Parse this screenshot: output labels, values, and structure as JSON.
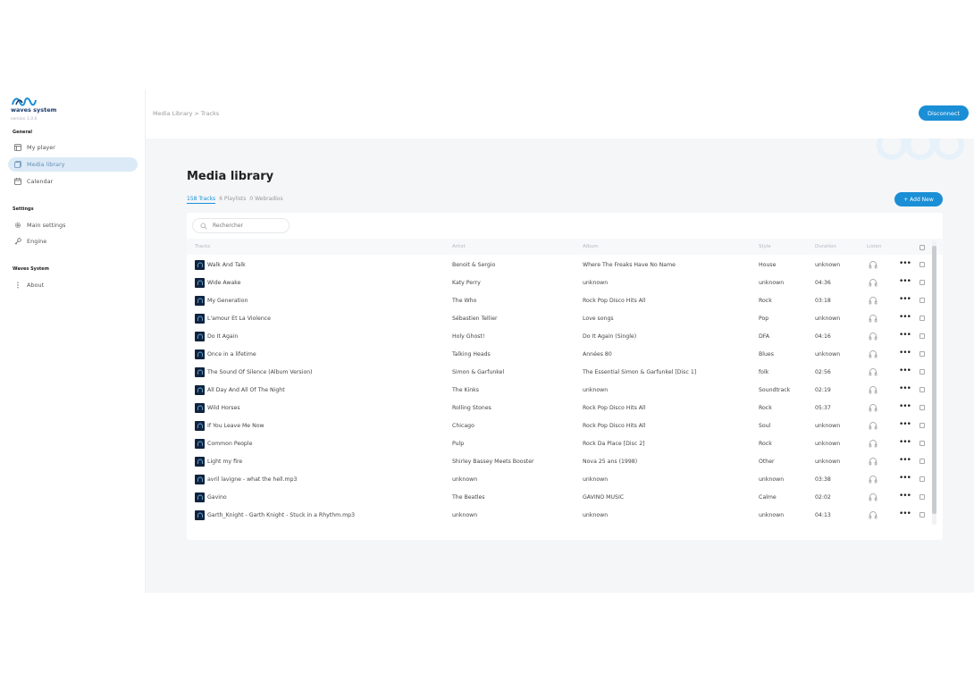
{
  "brand": {
    "name": "waves system",
    "version": "version 1.0.0"
  },
  "sidebar": {
    "sections": [
      {
        "title": "General",
        "items": [
          {
            "label": "My player",
            "icon": "player-icon"
          },
          {
            "label": "Media library",
            "icon": "library-icon",
            "active": true
          },
          {
            "label": "Calendar",
            "icon": "calendar-icon"
          }
        ]
      },
      {
        "title": "Settings",
        "items": [
          {
            "label": "Main settings",
            "icon": "gear-icon"
          },
          {
            "label": "Engine",
            "icon": "key-icon"
          }
        ]
      },
      {
        "title": "Waves System",
        "items": [
          {
            "label": "About",
            "icon": "dots-vertical-icon"
          }
        ]
      }
    ]
  },
  "topbar": {
    "breadcrumb": "Media Library > Tracks",
    "disconnect_label": "Disconnect"
  },
  "main": {
    "title": "Media library",
    "subtabs": [
      "158 Tracks",
      "6 Playlists",
      "0 Webradios"
    ],
    "add_new_label": "+ Add New",
    "search_placeholder": "Rechercher",
    "columns": [
      "Tracks",
      "Artist",
      "Album",
      "Style",
      "Duration",
      "Listen"
    ],
    "rows": [
      {
        "track": "Walk And Talk",
        "artist": "Benoit & Sergio",
        "album": "Where The Freaks Have No Name",
        "style": "House",
        "duration": "unknown"
      },
      {
        "track": "Wide Awake",
        "artist": "Katy Perry",
        "album": "unknown",
        "style": "unknown",
        "duration": "04:36"
      },
      {
        "track": "My Generation",
        "artist": "The Who",
        "album": "Rock Pop Disco Hits All",
        "style": "Rock",
        "duration": "03:18"
      },
      {
        "track": "L'amour Et La Violence",
        "artist": "Sébastien Tellier",
        "album": "Love songs",
        "style": "Pop",
        "duration": "unknown"
      },
      {
        "track": "Do It Again",
        "artist": "Holy Ghost!",
        "album": "Do It Again (Single)",
        "style": "DFA",
        "duration": "04:16"
      },
      {
        "track": "Once in a lifetime",
        "artist": "Talking Heads",
        "album": "Années 80",
        "style": "Blues",
        "duration": "unknown"
      },
      {
        "track": "The Sound Of Silence (Album Version)",
        "artist": "Simon & Garfunkel",
        "album": "The Essential Simon & Garfunkel [Disc 1]",
        "style": "folk",
        "duration": "02:56"
      },
      {
        "track": "All Day And All Of The Night",
        "artist": "The Kinks",
        "album": "unknown",
        "style": "Soundtrack",
        "duration": "02:19"
      },
      {
        "track": "Wild Horses",
        "artist": "Rolling Stones",
        "album": "Rock Pop Disco Hits All",
        "style": "Rock",
        "duration": "05:37"
      },
      {
        "track": "If You Leave Me Now",
        "artist": "Chicago",
        "album": "Rock Pop Disco Hits All",
        "style": "Soul",
        "duration": "unknown"
      },
      {
        "track": "Common People",
        "artist": "Pulp",
        "album": "Rock Da Place [Disc 2]",
        "style": "Rock",
        "duration": "unknown"
      },
      {
        "track": "Light my fire",
        "artist": "Shirley Bassey Meets Booster",
        "album": "Nova 25 ans (1998)",
        "style": "Other",
        "duration": "unknown"
      },
      {
        "track": "avril lavigne - what the hell.mp3",
        "artist": "unknown",
        "album": "unknown",
        "style": "unknown",
        "duration": "03:38"
      },
      {
        "track": "Gavino",
        "artist": "The Beatles",
        "album": "GAVINO MUSIC",
        "style": "Calme",
        "duration": "02:02"
      },
      {
        "track": "Garth_Knight - Garth Knight - Stuck in a Rhythm.mp3",
        "artist": "unknown",
        "album": "unknown",
        "style": "unknown",
        "duration": "04:13"
      }
    ]
  },
  "colors": {
    "accent": "#1a8fd6",
    "active_nav_bg": "#dbeaf6",
    "thumb": "#10243f",
    "main_bg": "#f5f6f8"
  }
}
